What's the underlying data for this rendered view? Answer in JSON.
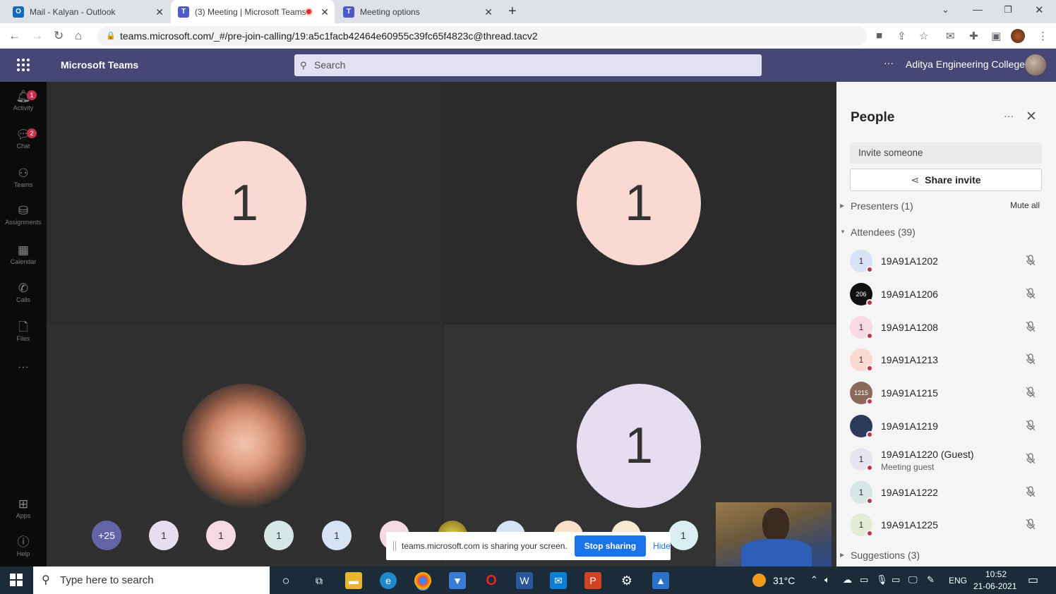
{
  "browser": {
    "tabs": [
      {
        "title": "Mail - Kalyan - Outlook",
        "icon": "outlook-icon",
        "active": false
      },
      {
        "title": "(3) Meeting | Microsoft Teams",
        "icon": "teams-icon",
        "active": true,
        "recording": true
      },
      {
        "title": "Meeting options",
        "icon": "teams-icon",
        "active": false
      }
    ],
    "new_tab": "+",
    "url": "teams.microsoft.com/_#/pre-join-calling/19:a5c1facb42464e60955c39fc65f4823c@thread.tacv2"
  },
  "teams": {
    "app_name": "Microsoft Teams",
    "search_placeholder": "Search",
    "more": "···",
    "org_name": "Aditya Engineering College"
  },
  "rail": [
    {
      "label": "Activity",
      "icon": "bell-icon",
      "badge": "1"
    },
    {
      "label": "Chat",
      "icon": "chat-icon",
      "badge": "2"
    },
    {
      "label": "Teams",
      "icon": "teams-icon",
      "badge": ""
    },
    {
      "label": "Assignments",
      "icon": "assignments-icon",
      "badge": ""
    },
    {
      "label": "Calendar",
      "icon": "calendar-icon",
      "badge": ""
    },
    {
      "label": "Calls",
      "icon": "phone-icon",
      "badge": ""
    },
    {
      "label": "Files",
      "icon": "file-icon",
      "badge": ""
    },
    {
      "label": "Apps",
      "icon": "apps-icon",
      "badge": ""
    },
    {
      "label": "Help",
      "icon": "help-icon",
      "badge": ""
    }
  ],
  "stage": {
    "tiles": [
      {
        "initial": "1",
        "color": "#fbd9d3"
      },
      {
        "initial": "1",
        "color": "#fbd9d3"
      },
      {
        "initial": "",
        "color": "rose-photo"
      },
      {
        "initial": "1",
        "color": "#e5def0"
      }
    ],
    "overflow_count": "+25",
    "small_avatars": [
      "1",
      "1",
      "1",
      "1",
      "1"
    ],
    "share_bar": {
      "message": "teams.microsoft.com is sharing your screen.",
      "stop": "Stop sharing",
      "hide": "Hide"
    }
  },
  "people": {
    "title": "People",
    "invite_placeholder": "Invite someone",
    "share_invite": "Share invite",
    "presenters": "Presenters (1)",
    "mute_all": "Mute all",
    "attendees": "Attendees (39)",
    "list": [
      {
        "name": "19A91A1202",
        "sub": "",
        "avatar": "1",
        "color": "#d7e3f4"
      },
      {
        "name": "19A91A1206",
        "sub": "",
        "avatar": "206",
        "color": "#111111"
      },
      {
        "name": "19A91A1208",
        "sub": "",
        "avatar": "1",
        "color": "#f6d9e4"
      },
      {
        "name": "19A91A1213",
        "sub": "",
        "avatar": "1",
        "color": "#fbd9d3"
      },
      {
        "name": "19A91A1215",
        "sub": "",
        "avatar": "1215",
        "color": "#8a6a5a"
      },
      {
        "name": "19A91A1219",
        "sub": "",
        "avatar": "",
        "color": "#2d3b5c"
      },
      {
        "name": "19A91A1220 (Guest)",
        "sub": "Meeting guest",
        "avatar": "1",
        "color": "#e8e4f2"
      },
      {
        "name": "19A91A1222",
        "sub": "",
        "avatar": "1",
        "color": "#d8e6e6"
      },
      {
        "name": "19A91A1225",
        "sub": "",
        "avatar": "1",
        "color": "#e4ecd8"
      }
    ],
    "suggestions": "Suggestions (3)"
  },
  "taskbar": {
    "search_placeholder": "Type here to search",
    "weather": "31°C",
    "language": "ENG",
    "time": "10:52",
    "date": "21-06-2021"
  }
}
